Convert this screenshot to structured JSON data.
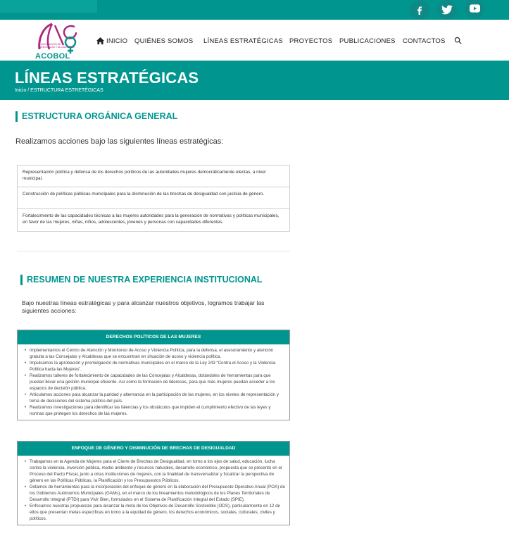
{
  "header": {
    "logo_text": "ACOBOL",
    "nav": [
      "INICIO",
      "QUIÉNES SOMOS",
      "LÍNEAS ESTRATÉGICAS",
      "PROYECTOS",
      "PUBLICACIONES",
      "CONTACTOS"
    ]
  },
  "social": {
    "icons": [
      "facebook-icon",
      "twitter-icon",
      "youtube-icon"
    ]
  },
  "banner": {
    "title": "LÍNEAS ESTRATÉGICAS",
    "breadcrumb": "Inicio / ESTRUCTURA ESTRETÉGICAS"
  },
  "section1": {
    "heading": "ESTRUCTURA ORGÁNICA GENERAL",
    "intro": "Realizamos acciones bajo las siguientes líneas estratégicas:",
    "lines": [
      "Representación política y defensa de los derechos políticos de las autoridades mujeres democráticamente electas, a nivel municipal.",
      "Construcción de políticas públicas municipales para la disminución de las brechas de desigualdad con justicia de género.",
      "Fortalecimiento de las capacidades técnicas a las mujeres autoridades para la generación de normativas y políticas municipales, en favor de las mujeres, niñas, niños, adolescentes, jóvenes y personas con capacidades diferentes."
    ]
  },
  "section2": {
    "heading": "RESUMEN DE NUESTRA EXPERIENCIA INSTITUCIONAL",
    "intro": "Bajo nuestras líneas estratégicas y para alcanzar nuestros objetivos, logramos trabajar las siguientes acciones:",
    "box1": {
      "title": "DERECHOS POLÍTICOS DE LAS MUJERES",
      "items": [
        "Implementamos el Centro de Atención y Monitoreo de Acoso y Violencia Política, para la defensa, el asesoramiento y atención gratuita a las Concejalas y Alcaldesas que se encuentran en situación de acoso y violencia política.",
        "Impulsamos la aprobación y promulgación de normativas municipales en el marco de la Ley 243 “Contra el Acoso y la Violencia Política hacia las Mujeres”.",
        "Realizamos talleres de fortalecimiento de capacidades de las Concejalas y Alcaldesas, dotándoles de herramientas para que puedan llevar una gestión municipal eficiente. Así como la formación de lideresas, para que más mujeres puedan acceder a los espacios de decisión pública.",
        "Articulamos acciones para alcanzar la paridad y alternancia en la participación de las mujeres, en los niveles de representación y toma de decisiones del sistema político del país.",
        "Realizamos investigaciones para identificar las falencias y los obstáculos que impiden el cumplimiento efectivo de las leyes y normas que protegen los derechos de las mujeres."
      ]
    },
    "box2": {
      "title": "ENFOQUE DE GÉNERO Y DISMINUCIÓN DE BRECHAS DE DESIGUALDAD",
      "items": [
        "Trabajamos en la Agenda de Mujeres para el Cierre de Brechas de Desigualdad, en torno a los ejes de salud, educación, lucha contra la violencia, inversión pública, medio ambiente y recursos naturales, desarrollo económico, propuesta que se presentó en el Proceso del Pacto Fiscal, junto a otras instituciones de mujeres, con la finalidad de transversalizar y focalizar la perspectiva de género en las Políticas Públicas, la Planificación y los Presupuestos Públicos.",
        "Dotamos de herramientas para la incorporación del enfoque de género en la elaboración del Presupuesto Operativo Anual (POA) de los Gobiernos Autónomos Municipales (GAMs), en el marco de los lineamientos metodológicos de los Planes Territoriales de Desarrollo Integral (PTDI) para Vivir Bien, formulados en el Sistema de Planificación Integral del Estado (SPIE).",
        "Enfocamos nuestras propuestas para alcanzar la meta de los Objetivos de Desarrollo Sostenible (ODS), particularmente en 12 de ellos que presentan metas específicas en torno a la equidad de género, los derechos económicos, sociales, culturales, civiles y políticos."
      ]
    }
  }
}
